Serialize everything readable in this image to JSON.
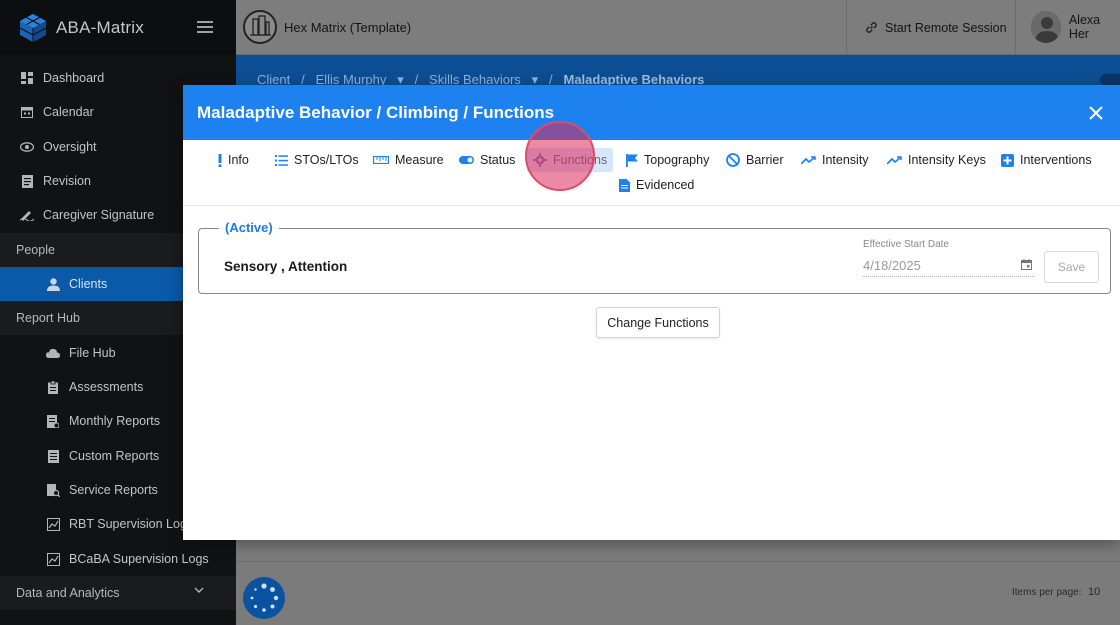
{
  "app": {
    "name": "ABA-Matrix"
  },
  "sidebar": {
    "items": [
      {
        "label": "Dashboard"
      },
      {
        "label": "Calendar"
      },
      {
        "label": "Oversight"
      },
      {
        "label": "Revision"
      },
      {
        "label": "Caregiver Signature"
      },
      {
        "label": "People"
      },
      {
        "label": "Clients"
      },
      {
        "label": "Report Hub"
      },
      {
        "label": "File Hub"
      },
      {
        "label": "Assessments"
      },
      {
        "label": "Monthly Reports"
      },
      {
        "label": "Custom Reports"
      },
      {
        "label": "Service Reports"
      },
      {
        "label": "RBT Supervision Logs"
      },
      {
        "label": "BCaBA Supervision Logs"
      },
      {
        "label": "Data and Analytics"
      }
    ]
  },
  "topbar": {
    "org_name": "Hex Matrix (Template)",
    "remote_session": "Start Remote Session",
    "user_name": "Alexa Her"
  },
  "breadcrumb": {
    "root": "Client",
    "client": "Ellis Murphy",
    "section": "Skills Behaviors",
    "current": "Maladaptive Behaviors"
  },
  "modal": {
    "title": "Maladaptive Behavior / Climbing / Functions",
    "tabs": [
      {
        "label": "Info",
        "icon": "exclamation-icon"
      },
      {
        "label": "STOs/LTOs",
        "icon": "list-icon"
      },
      {
        "label": "Measure",
        "icon": "ruler-icon"
      },
      {
        "label": "Status",
        "icon": "toggle-icon"
      },
      {
        "label": "Functions",
        "icon": "gear-icon"
      },
      {
        "label": "Topography",
        "icon": "flag-icon"
      },
      {
        "label": "Barrier",
        "icon": "block-icon"
      },
      {
        "label": "Intensity",
        "icon": "trend-icon"
      },
      {
        "label": "Intensity Keys",
        "icon": "trend-icon"
      },
      {
        "label": "Interventions",
        "icon": "plus-box-icon"
      },
      {
        "label": "Evidenced",
        "icon": "document-icon"
      }
    ],
    "active_tab": "Functions",
    "record": {
      "status": "(Active)",
      "functions": "Sensory , Attention",
      "date_label": "Effective Start Date",
      "date_value": "4/18/2025",
      "save_label": "Save"
    },
    "change_label": "Change Functions"
  },
  "footer": {
    "items_per_page_label": "Items per page:",
    "items_per_page_value": "10"
  },
  "colors": {
    "primary": "#1d82f0",
    "sidebar_bg": "#111214",
    "active_nav": "#0a5aa8",
    "status_text": "#1a7be0",
    "click_highlight": "#e04a6a"
  }
}
